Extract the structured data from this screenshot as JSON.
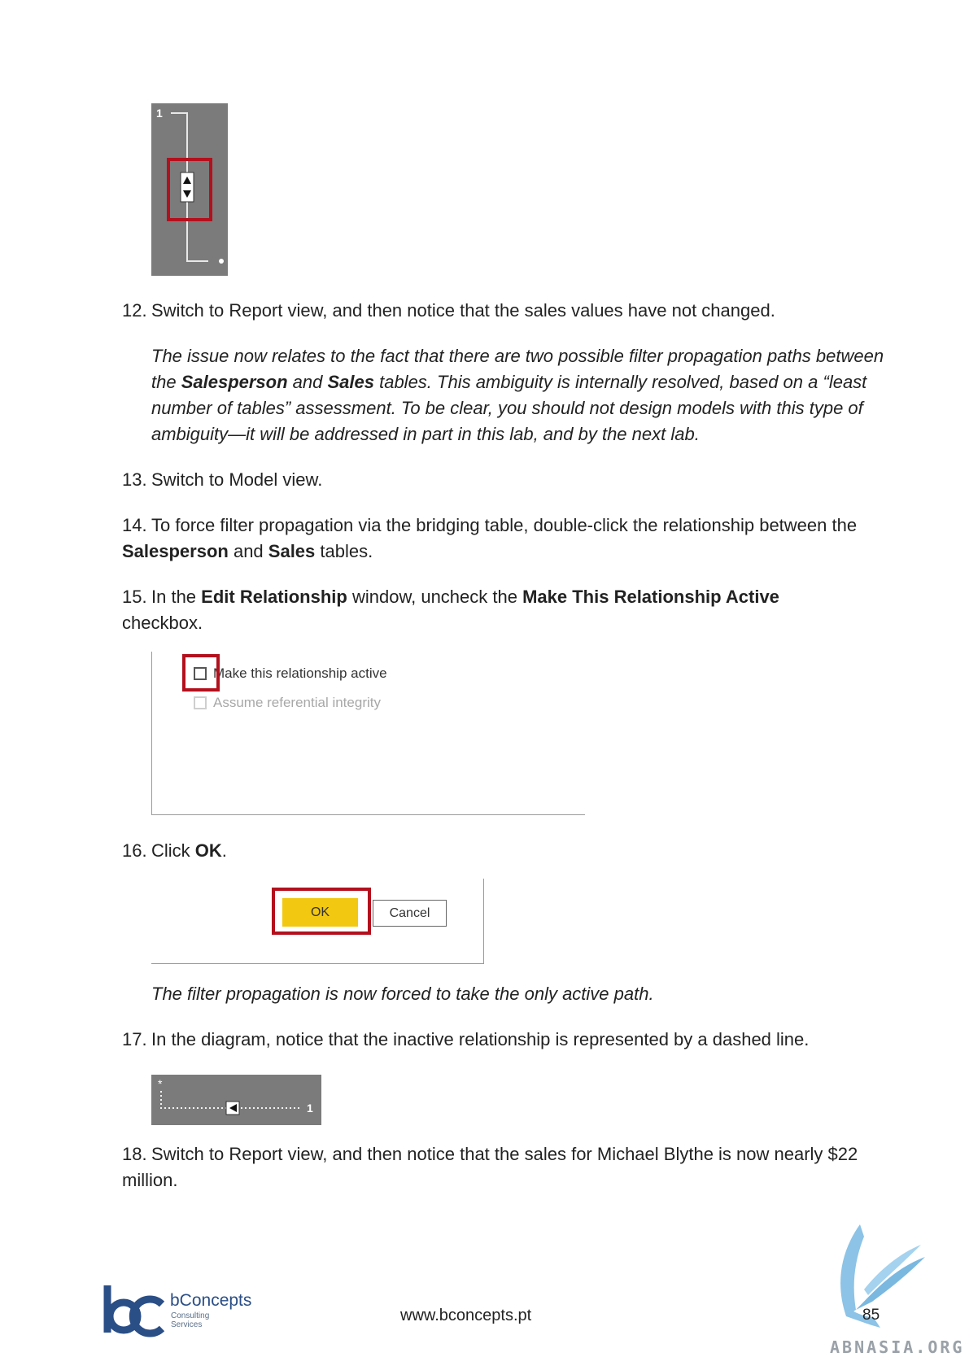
{
  "fig1": {
    "label_one": "1"
  },
  "step12": {
    "num": "12.",
    "text": "Switch to Report view, and then notice that the sales values have not changed."
  },
  "note12": {
    "t1": "The issue now relates to the fact that there are two possible filter propagation paths between the ",
    "b1": "Salesperson",
    "t2": " and ",
    "b2": "Sales",
    "t3": " tables. This ambiguity is internally resolved, based on a “least number of tables” assessment. To be clear, you should not design models with this type of ambiguity—it will be addressed in part in this lab, and by the next lab."
  },
  "step13": {
    "num": "13.",
    "text": "Switch to Model view."
  },
  "step14": {
    "num": "14.",
    "t1": "To force filter propagation via the bridging table, double-click the relationship between the ",
    "b1": "Salesperson",
    "t2": " and ",
    "b2": "Sales",
    "t3": " tables."
  },
  "step15": {
    "num": "15.",
    "t1": "In the ",
    "b1": "Edit Relationship",
    "t2": " window, uncheck the ",
    "b2": "Make This Relationship Active",
    "t3": " checkbox."
  },
  "fig2": {
    "checkbox1_label": "Make this relationship active",
    "checkbox2_label": "Assume referential integrity"
  },
  "step16": {
    "num": "16.",
    "t1": "Click ",
    "b1": "OK",
    "t2": "."
  },
  "fig3": {
    "ok_label": "OK",
    "cancel_label": "Cancel"
  },
  "note16": {
    "text": "The filter propagation is now forced to take the only active path."
  },
  "step17": {
    "num": "17.",
    "text": "In the diagram, notice that the inactive relationship is represented by a dashed line."
  },
  "fig4": {
    "label_star": "*",
    "label_one": "1"
  },
  "step18": {
    "num": "18.",
    "text": "Switch to Report view, and then notice that the sales for Michael Blythe is now nearly $22 million."
  },
  "footer": {
    "logo_name": "bConcepts",
    "logo_sub1": "Consulting",
    "logo_sub2": "Services",
    "url": "www.bconcepts.pt",
    "page_number": "85",
    "watermark": "ABNASIA.ORG"
  },
  "colors": {
    "highlight_red": "#b3101d",
    "ok_yellow": "#f2c811",
    "panel_gray": "#7b7b7b",
    "logo_blue": "#2a4e86"
  }
}
